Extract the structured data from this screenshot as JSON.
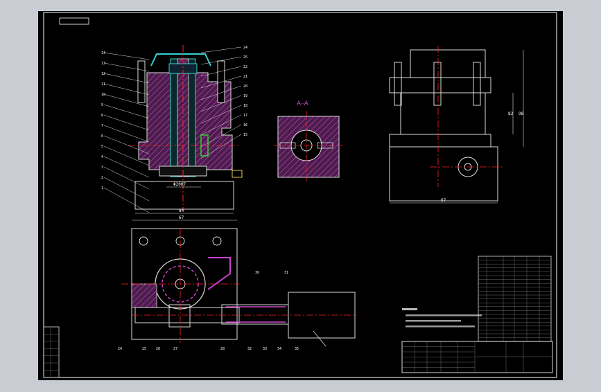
{
  "drawing": {
    "section_label": "A–A",
    "dimension_labels": {
      "bore": "Φ20H7",
      "base_width": "84",
      "side_height_inner": "82",
      "side_height_outer": "98",
      "side_width": "67",
      "plan_width": "67"
    },
    "leader_numbers_left": [
      "14",
      "13",
      "12",
      "11",
      "10",
      "9",
      "8",
      "7",
      "6",
      "5",
      "4",
      "3",
      "2",
      "1"
    ],
    "leader_numbers_right": [
      "24",
      "25",
      "22",
      "21",
      "20",
      "19",
      "18",
      "17",
      "16",
      "15"
    ],
    "leader_numbers_plan": [
      "24",
      "25",
      "26",
      "27",
      "28",
      "32",
      "33",
      "34",
      "35",
      "36",
      "31"
    ],
    "colors": {
      "background": "#000000",
      "frame": "#ffffff",
      "hatch": "#cc44cc",
      "centerline": "#ff2222",
      "section_label": "#cc44cc",
      "accent_green": "#33cc33",
      "accent_yellow": "#e6c84a",
      "accent_cyan": "#35d0d0"
    }
  }
}
